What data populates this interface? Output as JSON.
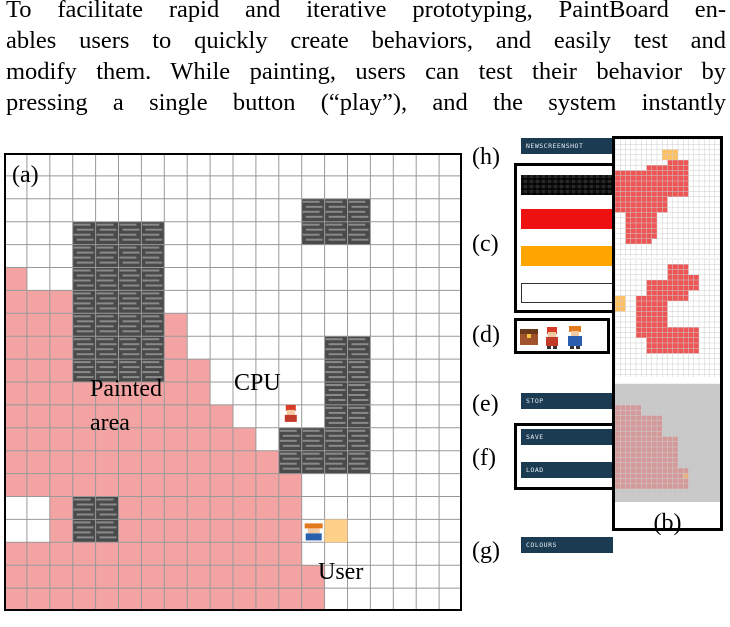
{
  "paragraph": {
    "line1": "To facilitate rapid and iterative prototyping, PaintBoard en-",
    "line2": "ables users to quickly create behaviors, and easily test and",
    "line3": "modify them. While painting, users can test their behavior by",
    "line4": "pressing a single button (“play”), and the system instantly"
  },
  "grid": {
    "panel_label": "(a)",
    "painted_label_1": "Painted",
    "painted_label_2": "area",
    "cpu_label": "CPU",
    "user_label": "User"
  },
  "side_labels": {
    "h": "(h)",
    "c": "(c)",
    "d": "(d)",
    "e": "(e)",
    "f": "(f)",
    "g": "(g)",
    "b": "(b)"
  },
  "buttons": {
    "new_screenshot": "NEWSCREENSHOT",
    "stop": "STOP",
    "save": "SAVE",
    "load": "LOAD",
    "colours": "COLOURS"
  },
  "colors": {
    "painted": "#f4a3a3",
    "stone": "#555555",
    "red_swatch": "#ee1111",
    "orange_swatch": "#ffa500",
    "button_bar": "#1b3b52"
  },
  "icons": {
    "sprite_1": "treasure-chest-icon",
    "sprite_2": "red-character-icon",
    "sprite_3": "blue-character-icon"
  }
}
